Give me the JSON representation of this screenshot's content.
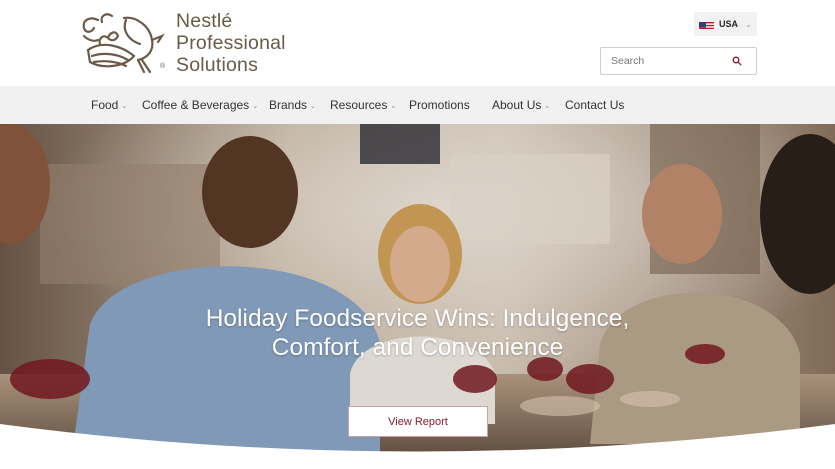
{
  "brand": {
    "logo_lines": [
      "Nestlé",
      "Professional",
      "Solutions"
    ]
  },
  "country_selector": {
    "label": "USA",
    "flag_icon": "us-flag-icon"
  },
  "search": {
    "placeholder": "Search",
    "icon": "search-icon"
  },
  "nav": {
    "items": [
      {
        "label": "Food",
        "has_dropdown": true
      },
      {
        "label": "Coffee & Beverages",
        "has_dropdown": true
      },
      {
        "label": "Brands",
        "has_dropdown": true
      },
      {
        "label": "Resources",
        "has_dropdown": true
      },
      {
        "label": "Promotions",
        "has_dropdown": false
      },
      {
        "label": "About Us",
        "has_dropdown": true
      },
      {
        "label": "Contact Us",
        "has_dropdown": false
      }
    ]
  },
  "hero": {
    "title_lines": [
      "Holiday Foodservice Wins: Indulgence,",
      "Comfort, and Convenience"
    ],
    "button_label": "View Report"
  },
  "colors": {
    "logo_brown": "#6b5a48",
    "accent_red": "#8a1c2b",
    "nav_bg": "#f1f1f1"
  }
}
